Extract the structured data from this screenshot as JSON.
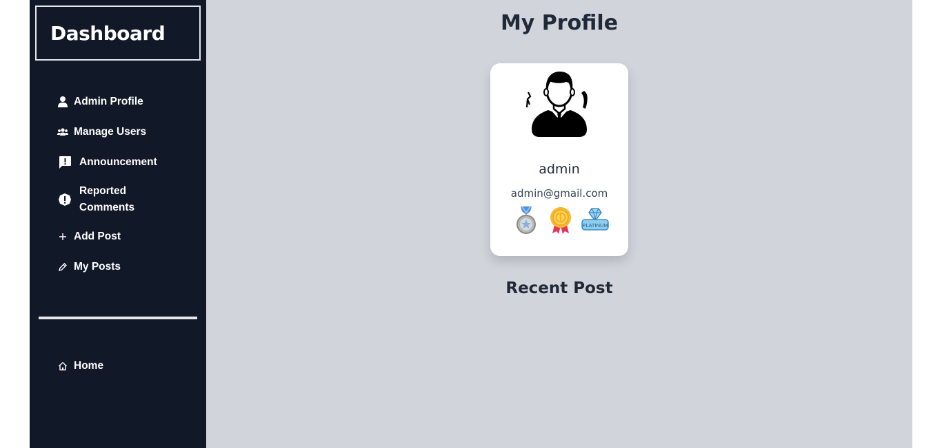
{
  "sidebar": {
    "brand": "Dashboard",
    "items": [
      {
        "label": "Admin Profile",
        "icon": "user-icon"
      },
      {
        "label": "Manage Users",
        "icon": "users-icon"
      },
      {
        "label": "Announcement",
        "icon": "announcement-icon"
      },
      {
        "label": "Reported Comments",
        "icon": "alert-circle-icon"
      },
      {
        "label": "Add Post",
        "icon": "plus-icon"
      },
      {
        "label": "My Posts",
        "icon": "pen-icon"
      }
    ],
    "home": {
      "label": "Home",
      "icon": "home-icon"
    }
  },
  "main": {
    "title": "My Profile",
    "profile": {
      "name": "admin",
      "email": "admin@gmail.com",
      "badges": [
        "silver-medal-icon",
        "gold-medal-icon",
        "platinum-badge-icon"
      ]
    },
    "recent_heading": "Recent Post"
  },
  "colors": {
    "sidebar_bg": "#111827",
    "main_bg": "#d1d5db",
    "card_bg": "#ffffff",
    "text": "#1f2937"
  }
}
